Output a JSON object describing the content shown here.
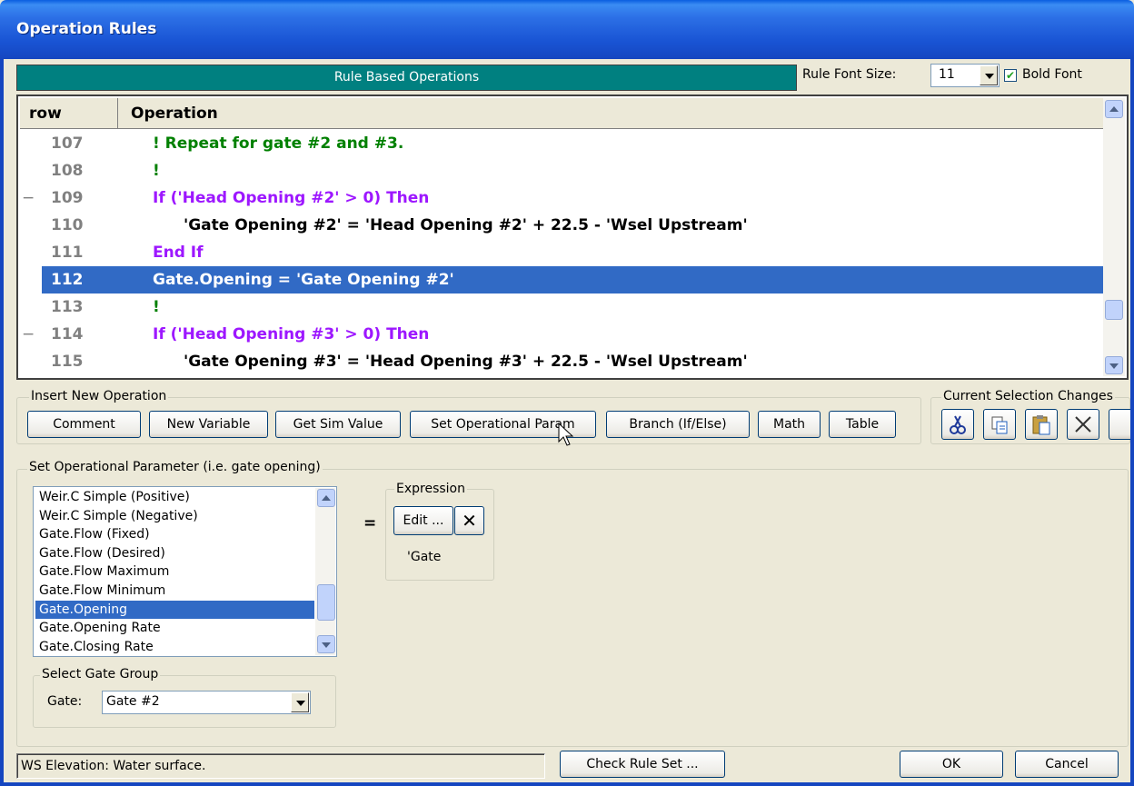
{
  "window": {
    "title": "Operation Rules"
  },
  "header": {
    "banner": "Rule Based Operations",
    "font_size_label": "Rule Font Size:",
    "font_size_value": "11",
    "bold_font_label": "Bold Font",
    "bold_font_checked": true
  },
  "grid": {
    "col_row": "row",
    "col_operation": "Operation",
    "rows": [
      {
        "num": "107",
        "text": "! Repeat for gate #2 and #3.",
        "color": "#008000",
        "indent": 0,
        "collapse": ""
      },
      {
        "num": "108",
        "text": "!",
        "color": "#008000",
        "indent": 0,
        "collapse": ""
      },
      {
        "num": "109",
        "text": "If ('Head Opening #2' > 0) Then",
        "color": "#9d17ff",
        "indent": 0,
        "collapse": "−"
      },
      {
        "num": "110",
        "text": "'Gate Opening #2' = 'Head Opening #2' + 22.5 - 'Wsel Upstream'",
        "color": "#000000",
        "indent": 1,
        "collapse": ""
      },
      {
        "num": "111",
        "text": "End If",
        "color": "#9d17ff",
        "indent": 0,
        "collapse": ""
      },
      {
        "num": "112",
        "text": "Gate.Opening = 'Gate Opening #2'",
        "color": "#000000",
        "indent": 0,
        "collapse": "",
        "selected": true
      },
      {
        "num": "113",
        "text": "!",
        "color": "#008000",
        "indent": 0,
        "collapse": ""
      },
      {
        "num": "114",
        "text": "If ('Head Opening #3' > 0) Then",
        "color": "#9d17ff",
        "indent": 0,
        "collapse": "−"
      },
      {
        "num": "115",
        "text": "'Gate Opening #3' = 'Head Opening #3' + 22.5 - 'Wsel Upstream'",
        "color": "#000000",
        "indent": 1,
        "collapse": ""
      }
    ]
  },
  "insert": {
    "legend": "Insert New Operation",
    "buttons": [
      "Comment",
      "New Variable",
      "Get Sim Value",
      "Set Operational Param",
      "Branch (If/Else)",
      "Math",
      "Table"
    ]
  },
  "selection_changes": {
    "legend": "Current Selection Changes",
    "icons": [
      "cut-icon",
      "copy-icon",
      "paste-icon",
      "delete-icon"
    ]
  },
  "set_param": {
    "legend": "Set Operational Parameter (i.e. gate opening)",
    "list_items": [
      "Weir.C Simple (Positive)",
      "Weir.C Simple (Negative)",
      "Gate.Flow (Fixed)",
      "Gate.Flow (Desired)",
      "Gate.Flow Maximum",
      "Gate.Flow Minimum",
      "Gate.Opening",
      "Gate.Opening Rate",
      "Gate.Closing Rate"
    ],
    "selected_item": "Gate.Opening",
    "equals": "=",
    "expression_legend": "Expression",
    "edit_label": "Edit ...",
    "expression_value": "'Gate",
    "gate_group_legend": "Select Gate Group",
    "gate_label": "Gate:",
    "gate_value": "Gate #2"
  },
  "footer": {
    "status": "WS Elevation: Water surface.",
    "check_label": "Check Rule Set ...",
    "ok_label": "OK",
    "cancel_label": "Cancel"
  }
}
